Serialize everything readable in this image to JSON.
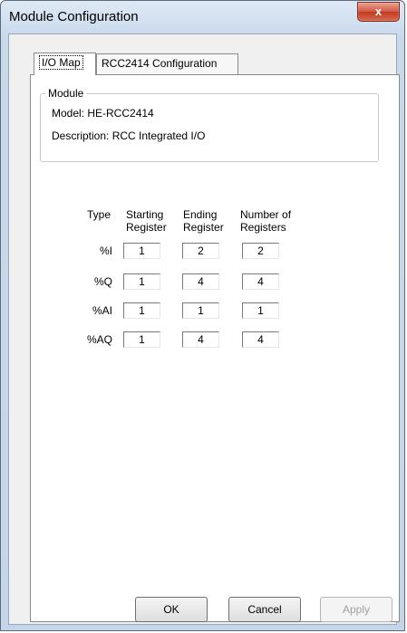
{
  "window": {
    "title": "Module Configuration",
    "close_label": "x"
  },
  "tabs": [
    {
      "label": "I/O Map",
      "active": true
    },
    {
      "label": "RCC2414 Configuration",
      "active": false
    }
  ],
  "module": {
    "legend": "Module",
    "model": "Model:  HE-RCC2414",
    "description": "Description:  RCC Integrated I/O"
  },
  "table": {
    "headers": {
      "type": "Type",
      "start": "Starting\nRegister",
      "end": "Ending\nRegister",
      "count": "Number of\nRegisters"
    },
    "rows": [
      {
        "type": "%I",
        "start": "1",
        "end": "2",
        "count": "2"
      },
      {
        "type": "%Q",
        "start": "1",
        "end": "4",
        "count": "4"
      },
      {
        "type": "%AI",
        "start": "1",
        "end": "1",
        "count": "1"
      },
      {
        "type": "%AQ",
        "start": "1",
        "end": "4",
        "count": "4"
      }
    ]
  },
  "buttons": {
    "ok": "OK",
    "cancel": "Cancel",
    "apply": "Apply"
  }
}
